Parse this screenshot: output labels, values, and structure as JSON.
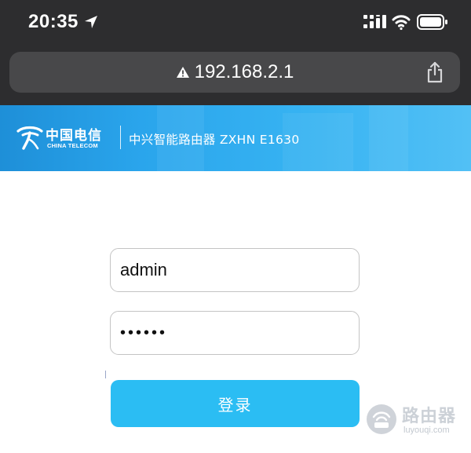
{
  "status_bar": {
    "time": "20:35",
    "icons": [
      "location-arrow-icon",
      "signal-icon",
      "wifi-icon",
      "battery-icon"
    ]
  },
  "browser": {
    "address": "192.168.2.1",
    "security_icon": "warning-icon",
    "share_icon": "share-icon"
  },
  "banner": {
    "logo_cn": "中国电信",
    "logo_en": "CHINA TELECOM",
    "title": "中兴智能路由器 ZXHN E1630"
  },
  "login": {
    "username_value": "admin",
    "password_value": "••••••",
    "submit_label": "登录"
  },
  "watermark": {
    "main": "路由器",
    "sub": "luyouqi.com"
  },
  "colors": {
    "chrome_bg": "#2d2d2f",
    "address_bar_bg": "#48484a",
    "banner_start": "#1e8fd8",
    "banner_end": "#52c0f5",
    "button_bg": "#2bbdf3",
    "input_border": "#c4c4c4"
  }
}
